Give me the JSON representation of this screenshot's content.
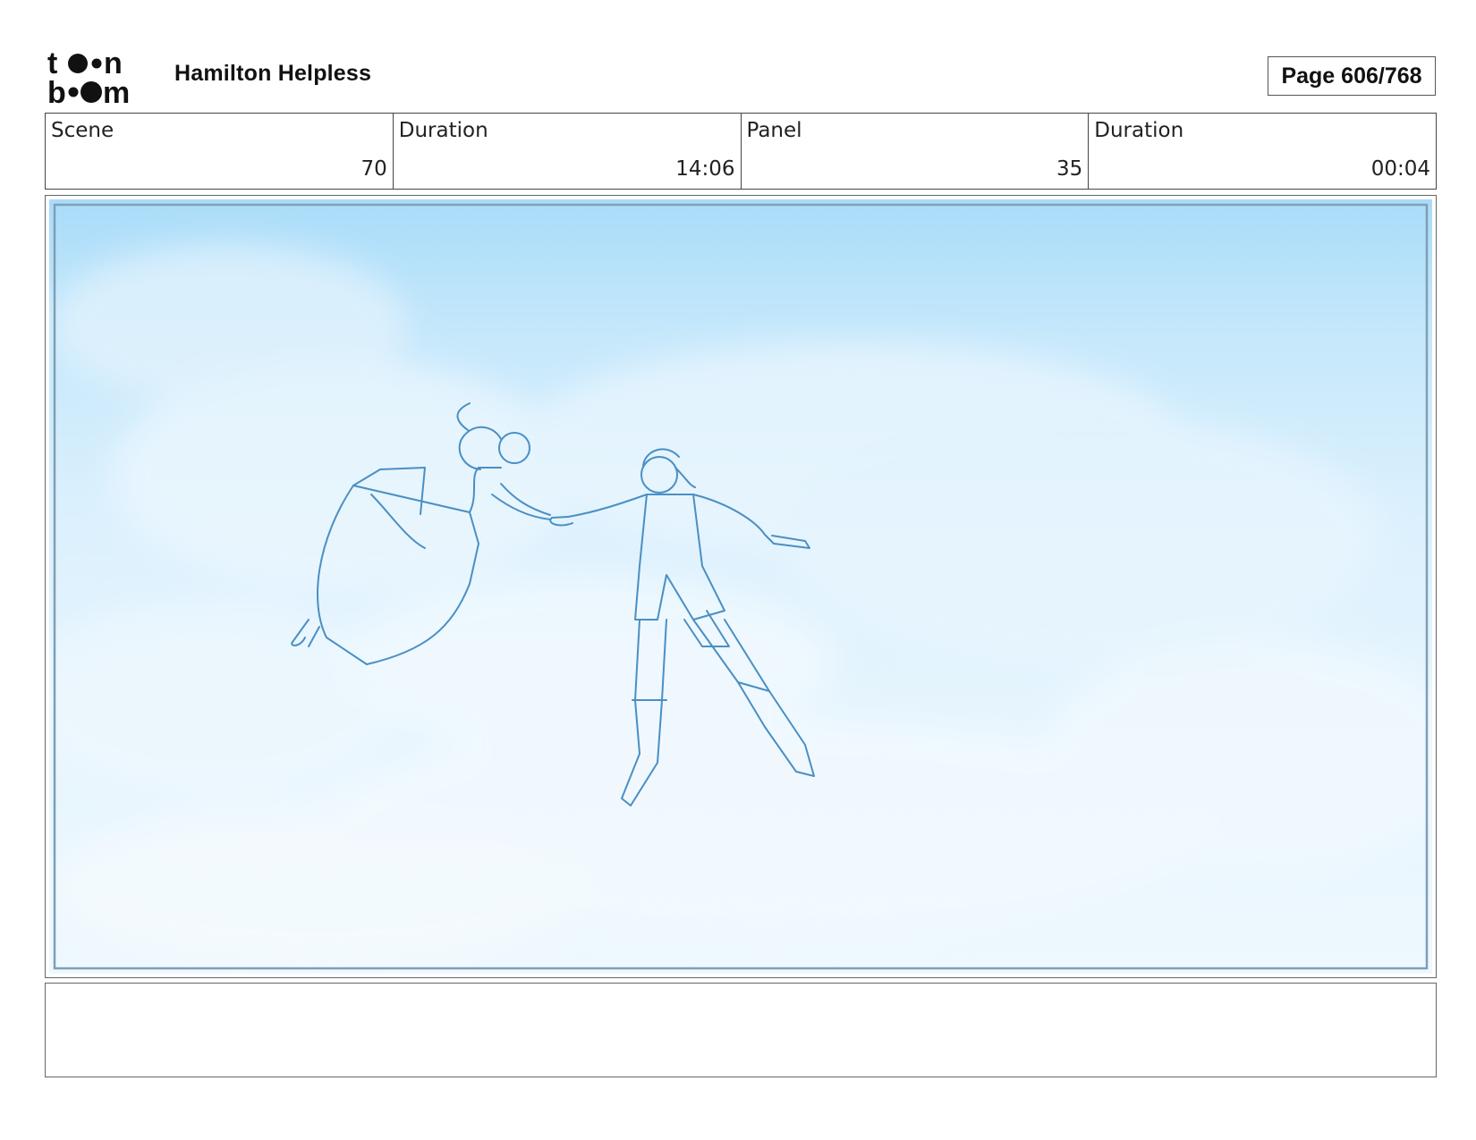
{
  "header": {
    "logo_text_top": "toon",
    "logo_text_bottom": "boom",
    "project_title": "Hamilton Helpless",
    "page_label": "Page",
    "page_value": "606/768"
  },
  "info": [
    {
      "label": "Scene",
      "value": "70"
    },
    {
      "label": "Duration",
      "value": "14:06"
    },
    {
      "label": "Panel",
      "value": "35"
    },
    {
      "label": "Duration",
      "value": "00:04"
    }
  ],
  "panel": {
    "sky_color": "#a9dcf9",
    "line_color": "#4a8fc4"
  },
  "notes": {
    "text": ""
  }
}
